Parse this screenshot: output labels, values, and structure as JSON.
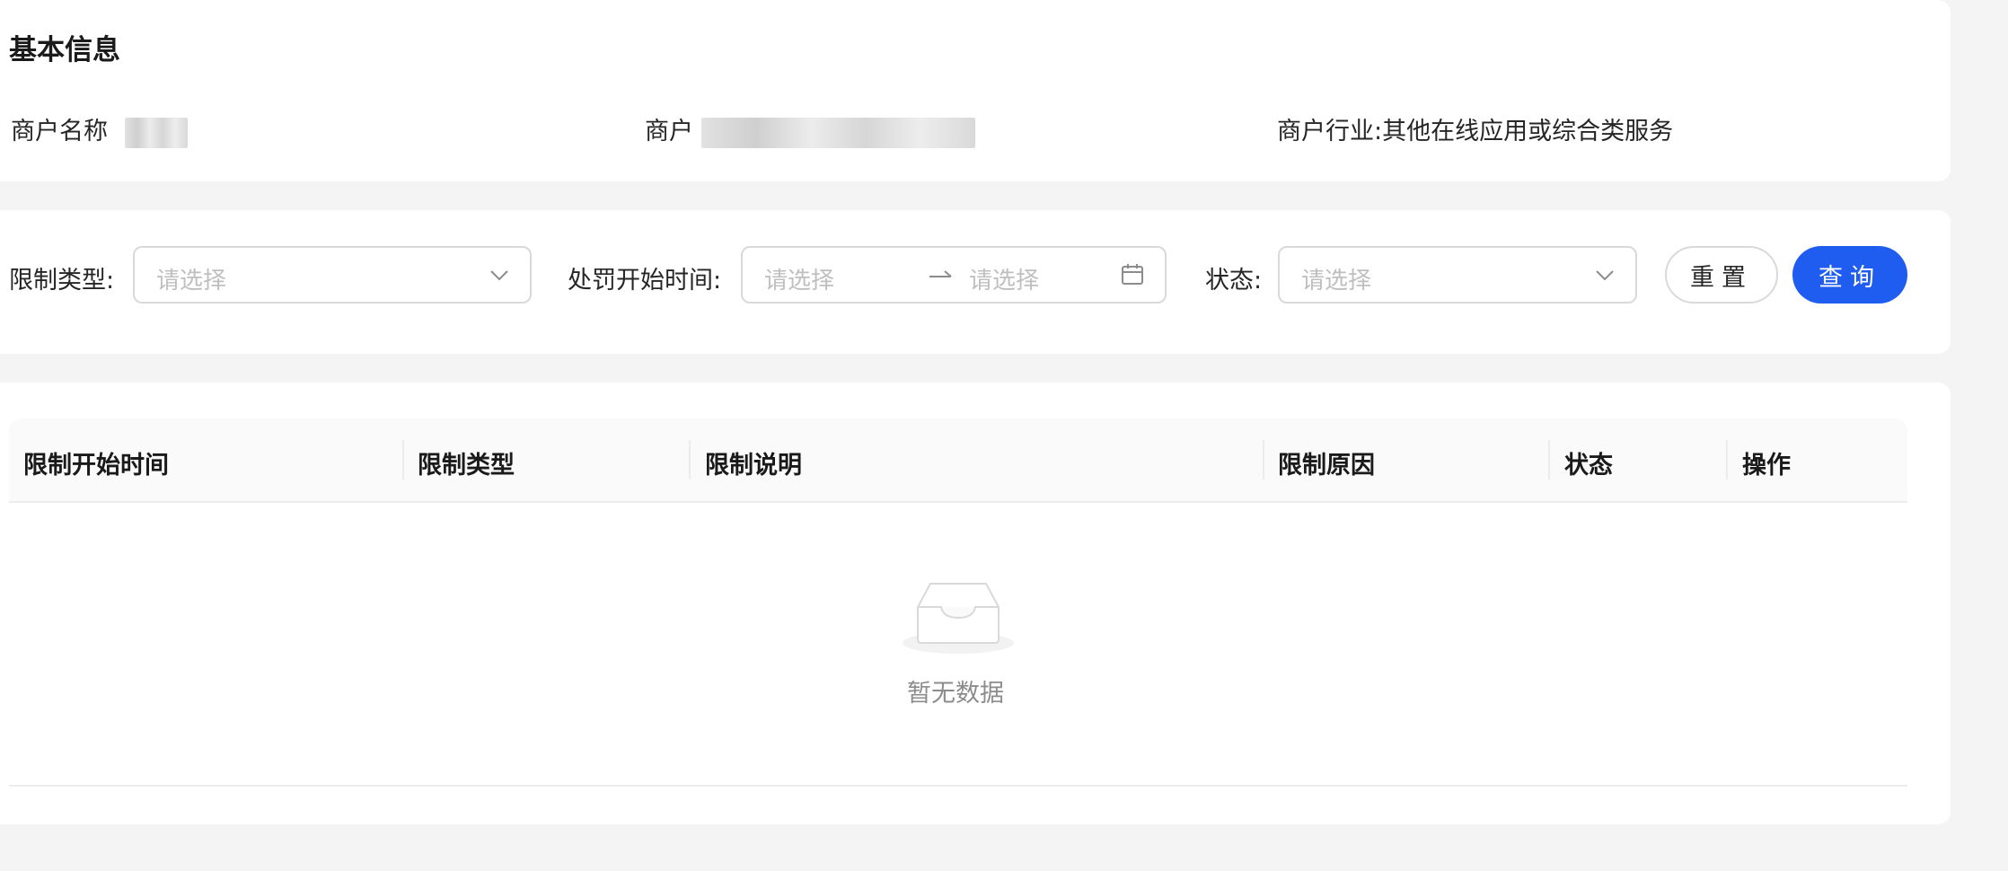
{
  "basic_info": {
    "title": "基本信息",
    "merchant_name_label": "商户名称",
    "merchant_id_label": "商户",
    "industry_label": "商户行业:",
    "industry_value": "其他在线应用或综合类服务"
  },
  "filters": {
    "restriction_type": {
      "label": "限制类型:",
      "placeholder": "请选择",
      "icon": "chevron-down-icon"
    },
    "penalty_start_time": {
      "label": "处罚开始时间:",
      "start_placeholder": "请选择",
      "end_placeholder": "请选择",
      "icon": "calendar-icon"
    },
    "status": {
      "label": "状态:",
      "placeholder": "请选择",
      "icon": "chevron-down-icon"
    },
    "reset_label": "重置",
    "query_label": "查询"
  },
  "table": {
    "columns": [
      "限制开始时间",
      "限制类型",
      "限制说明",
      "限制原因",
      "状态",
      "操作"
    ],
    "rows": [],
    "empty_text": "暂无数据"
  },
  "colors": {
    "primary": "#1f5cf0",
    "background": "#f4f4f5",
    "placeholder": "#bfbfbf"
  }
}
